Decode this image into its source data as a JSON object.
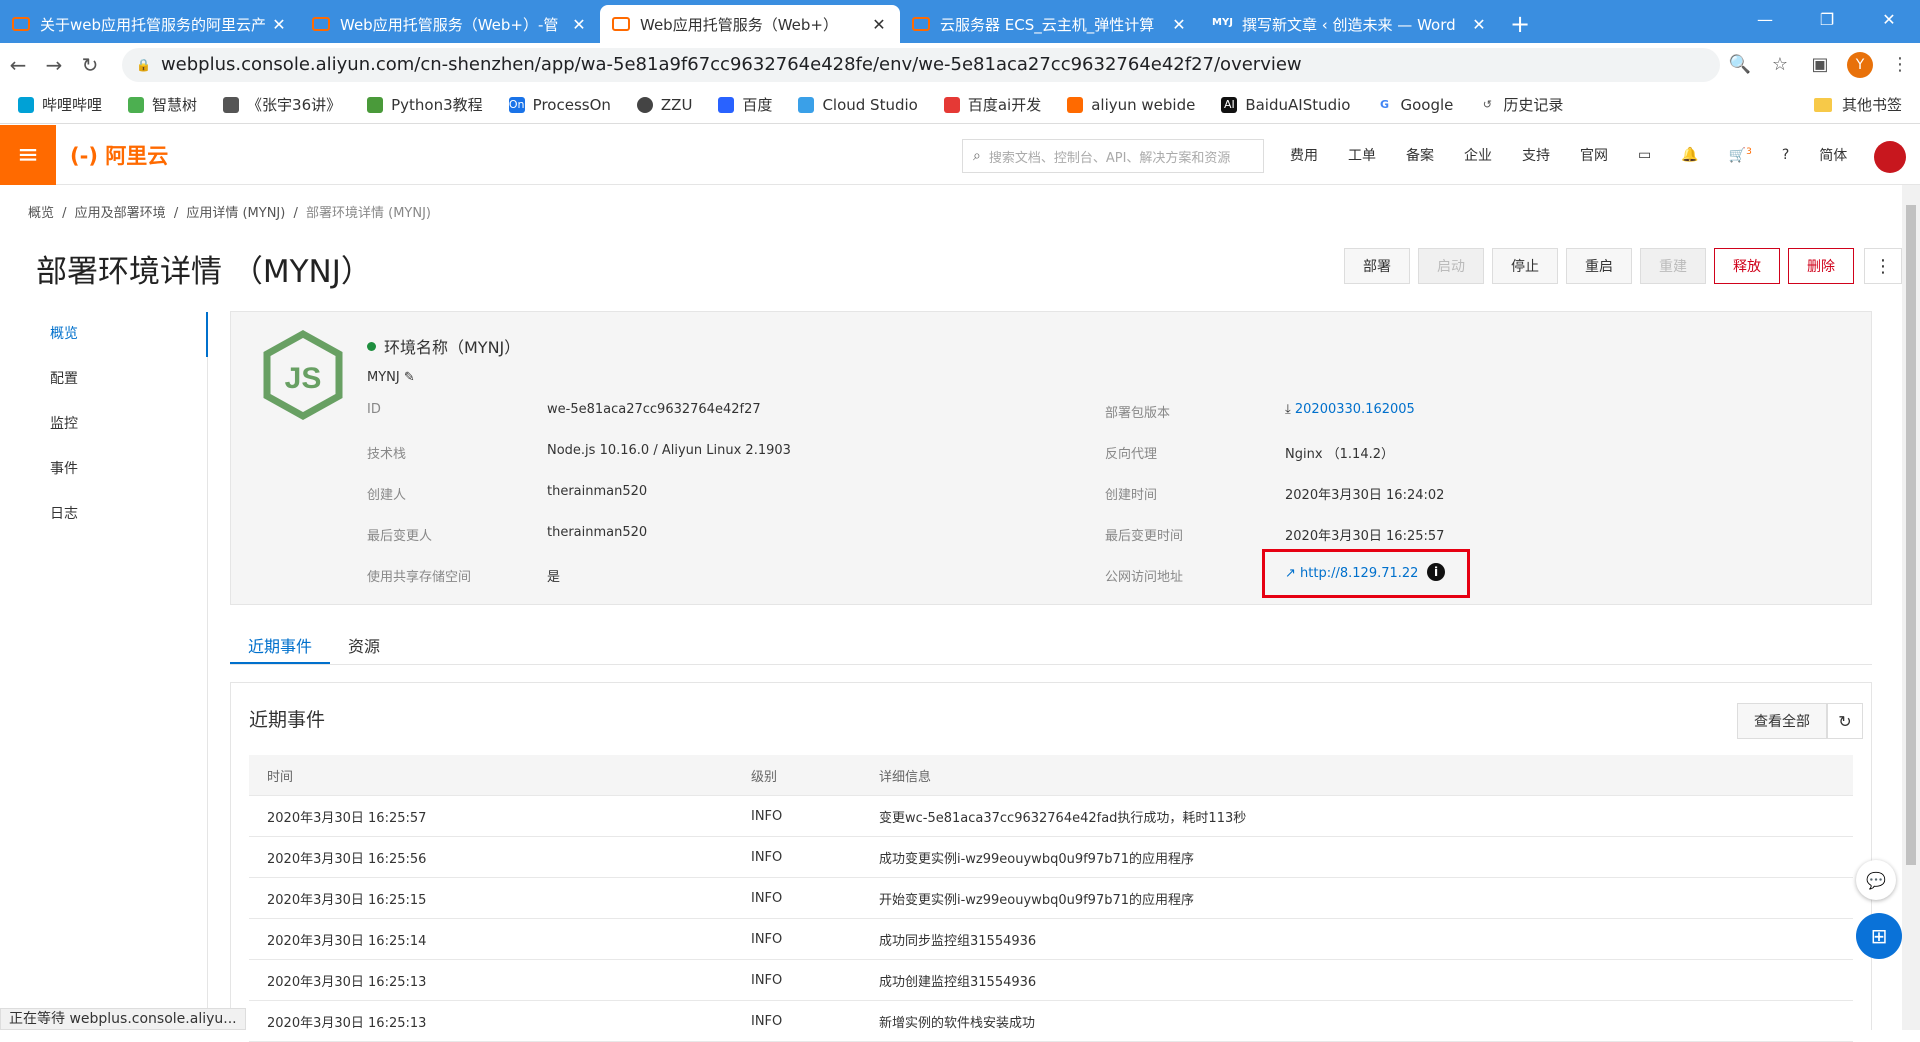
{
  "browser": {
    "tabs": [
      {
        "title": "关于web应用托管服务的阿里云产",
        "favicon": "aliyun-icon",
        "active": false
      },
      {
        "title": "Web应用托管服务（Web+）-管",
        "favicon": "aliyun-icon",
        "active": false
      },
      {
        "title": "Web应用托管服务（Web+）",
        "favicon": "aliyun-icon",
        "active": true
      },
      {
        "title": "云服务器 ECS_云主机_弹性计算",
        "favicon": "aliyun-icon",
        "active": false
      },
      {
        "title": "撰写新文章 ‹ 创造未来 — Word",
        "favicon": "MYJ",
        "active": false
      }
    ],
    "url": "webplus.console.aliyun.com/cn-shenzhen/app/wa-5e81a9f67cc9632764e428fe/env/we-5e81aca27cc9632764e42f27/overview",
    "profile_initial": "Y",
    "bookmarks": [
      "哔哩哔哩",
      "智慧树",
      "《张宇36讲》",
      "Python3教程",
      "ProcessOn",
      "ZZU",
      "百度",
      "Cloud Studio",
      "百度ai开发",
      "aliyun webide",
      "BaiduAIStudio",
      "Google",
      "历史记录"
    ],
    "other_bookmarks": "其他书签",
    "status_text": "正在等待 webplus.console.aliyu..."
  },
  "console": {
    "logo": "(-) 阿里云",
    "search_placeholder": "搜索文档、控制台、API、解决方案和资源",
    "nav": [
      "费用",
      "工单",
      "备案",
      "企业",
      "支持",
      "官网"
    ],
    "lang": "简体",
    "cart_count": "3"
  },
  "breadcrumb": [
    "概览",
    "应用及部署环境",
    "应用详情 (MYNJ)",
    "部署环境详情 (MYNJ)"
  ],
  "page_title": "部署环境详情 （MYNJ）",
  "actions": [
    "部署",
    "启动",
    "停止",
    "重启",
    "重建",
    "释放",
    "删除"
  ],
  "side_nav": [
    "概览",
    "配置",
    "监控",
    "事件",
    "日志"
  ],
  "env": {
    "status_label": "环境名称（MYNJ）",
    "name": "MYNJ",
    "left": [
      {
        "label": "ID",
        "value": "we-5e81aca27cc9632764e42f27"
      },
      {
        "label": "技术栈",
        "value": "Node.js 10.16.0 / Aliyun Linux 2.1903"
      },
      {
        "label": "创建人",
        "value": "therainman520"
      },
      {
        "label": "最后变更人",
        "value": "therainman520"
      },
      {
        "label": "使用共享存储空间",
        "value": "是"
      }
    ],
    "right": [
      {
        "label": "部署包版本",
        "value": "20200330.162005"
      },
      {
        "label": "反向代理",
        "value": "Nginx （1.14.2）"
      },
      {
        "label": "创建时间",
        "value": "2020年3月30日 16:24:02"
      },
      {
        "label": "最后变更时间",
        "value": "2020年3月30日 16:25:57"
      },
      {
        "label": "公网访问地址",
        "value": "http://8.129.71.22"
      }
    ]
  },
  "content_tabs": [
    "近期事件",
    "资源"
  ],
  "events": {
    "title": "近期事件",
    "view_all": "查看全部",
    "columns": [
      "时间",
      "级别",
      "详细信息"
    ],
    "rows": [
      [
        "2020年3月30日 16:25:57",
        "INFO",
        "变更wc-5e81aca37cc9632764e42fad执行成功，耗时113秒"
      ],
      [
        "2020年3月30日 16:25:56",
        "INFO",
        "成功变更实例i-wz99eouywbq0u9f97b71的应用程序"
      ],
      [
        "2020年3月30日 16:25:15",
        "INFO",
        "开始变更实例i-wz99eouywbq0u9f97b71的应用程序"
      ],
      [
        "2020年3月30日 16:25:14",
        "INFO",
        "成功同步监控组31554936"
      ],
      [
        "2020年3月30日 16:25:13",
        "INFO",
        "成功创建监控组31554936"
      ],
      [
        "2020年3月30日 16:25:13",
        "INFO",
        "新增实例的软件栈安装成功"
      ]
    ]
  }
}
